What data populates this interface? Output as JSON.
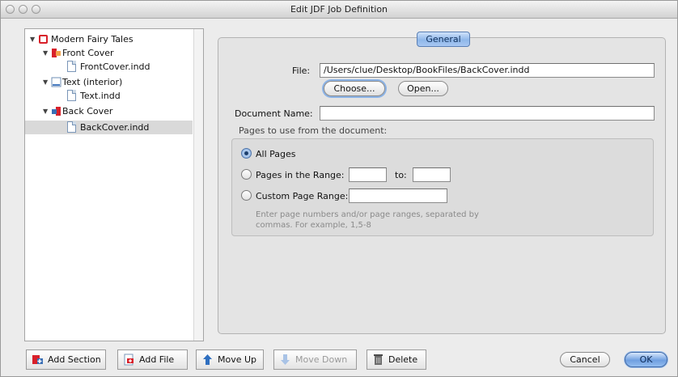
{
  "window": {
    "title": "Edit JDF Job Definition"
  },
  "tree": {
    "items": [
      {
        "label": "Modern Fairy Tales",
        "icon": "book-icon"
      },
      {
        "label": "Front Cover",
        "icon": "cover-section-icon"
      },
      {
        "label": "FrontCover.indd",
        "icon": "document-icon"
      },
      {
        "label": "Text (interior)",
        "icon": "text-section-icon"
      },
      {
        "label": "Text.indd",
        "icon": "document-icon"
      },
      {
        "label": "Back Cover",
        "icon": "back-cover-section-icon"
      },
      {
        "label": "BackCover.indd",
        "icon": "document-icon"
      }
    ],
    "selected": "BackCover.indd"
  },
  "panel": {
    "tab_label": "General",
    "file_label": "File:",
    "file_value": "/Users/clue/Desktop/BookFiles/BackCover.indd",
    "choose_label": "Choose...",
    "open_label": "Open...",
    "docname_label": "Document Name:",
    "docname_value": "",
    "pages_group_label": "Pages to use from the document:",
    "all_pages_label": "All Pages",
    "range_label": "Pages in the Range:",
    "range_to_label": "to:",
    "range_from_value": "",
    "range_to_value": "",
    "custom_label": "Custom Page Range:",
    "custom_value": "",
    "selected_option": "All Pages",
    "hint_line1": "Enter page numbers and/or page ranges, separated by",
    "hint_line2": "commas. For example, 1,5-8"
  },
  "toolbar": {
    "add_section": "Add Section",
    "add_file": "Add File",
    "move_up": "Move Up",
    "move_down": "Move Down",
    "delete": "Delete"
  },
  "dialog": {
    "cancel": "Cancel",
    "ok": "OK"
  },
  "colors": {
    "accent": "#7fa8df",
    "ok_button": "#6f9fe0"
  }
}
